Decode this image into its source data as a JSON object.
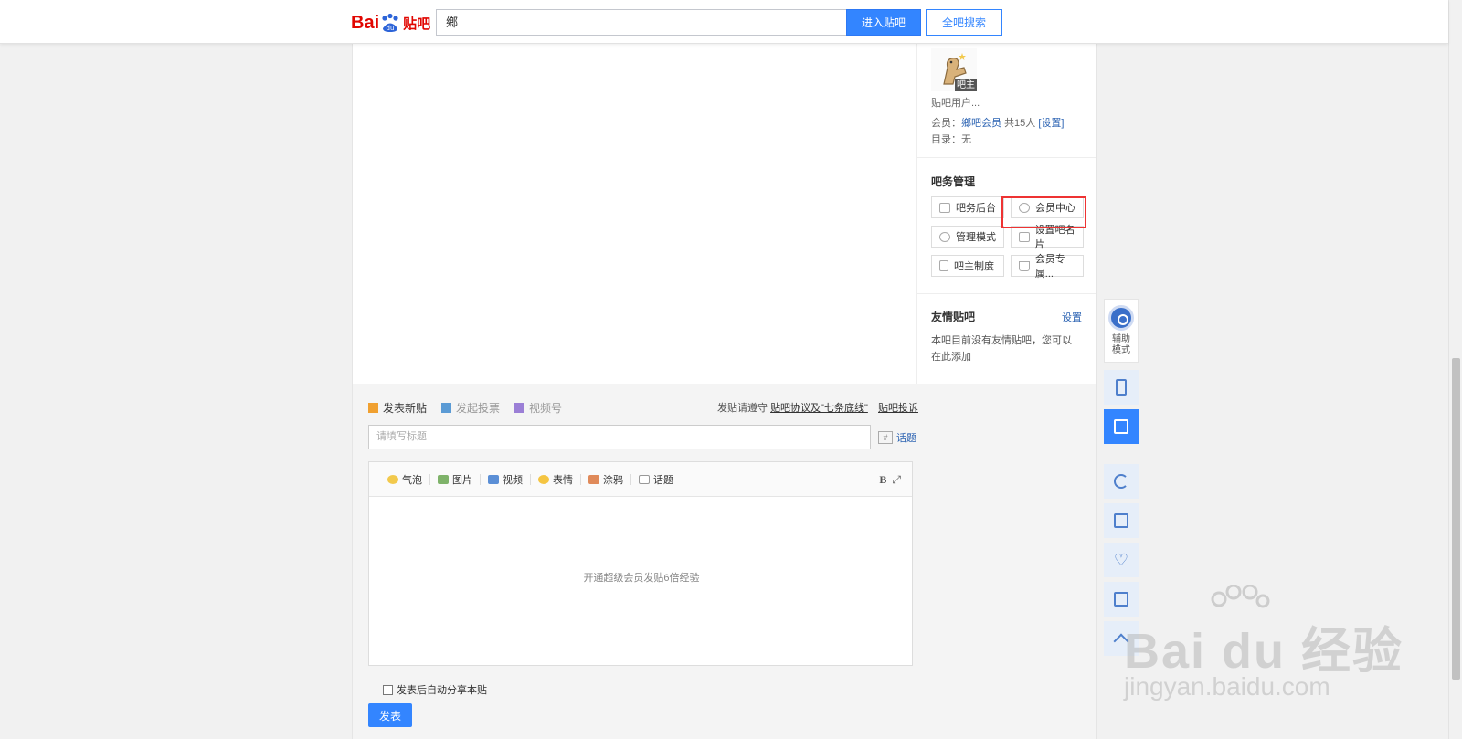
{
  "header": {
    "logo_bai": "Bai",
    "logo_tieba": "贴吧",
    "search_value": "鄉",
    "enter_button": "进入贴吧",
    "search_all_button": "全吧搜索"
  },
  "aside": {
    "avatar_badge": "吧主",
    "username": "贴吧用户...",
    "member_prefix": "会员：",
    "member_link": "鄉吧会员",
    "member_count": " 共15人 ",
    "member_settings": "[设置]",
    "directory_prefix": "目录：",
    "directory_value": "无",
    "management_title": "吧务管理",
    "management_buttons": [
      "吧务后台",
      "会员中心",
      "管理模式",
      "设置吧名片",
      "吧主制度",
      "会员专属..."
    ],
    "friends_title": "友情贴吧",
    "friends_settings": "设置",
    "friends_text": "本吧目前没有友情贴吧，您可以",
    "friends_add_link": "在此添加"
  },
  "editor": {
    "tabs": [
      "发表新贴",
      "发起投票",
      "视频号"
    ],
    "rules_prefix": "发贴请遵守 ",
    "rules_link": "贴吧协议及\"七条底线\"",
    "complaint_link": "贴吧投诉",
    "title_placeholder": "请填写标题",
    "topic_button": "话题",
    "toolbar": [
      "气泡",
      "图片",
      "视频",
      "表情",
      "涂鸦",
      "话题"
    ],
    "bold_label": "B",
    "hint": "开通超级会员发贴6倍经验",
    "share_label": "发表后自动分享本贴",
    "submit_label": "发表"
  },
  "float_tools": {
    "assist_label": "辅助模式"
  },
  "watermark": {
    "main": "Bai du 经验",
    "sub": "jingyan.baidu.com"
  },
  "colors": {
    "brand_blue": "#3385ff",
    "brand_red": "#e10601",
    "highlight_red": "#e33333"
  }
}
